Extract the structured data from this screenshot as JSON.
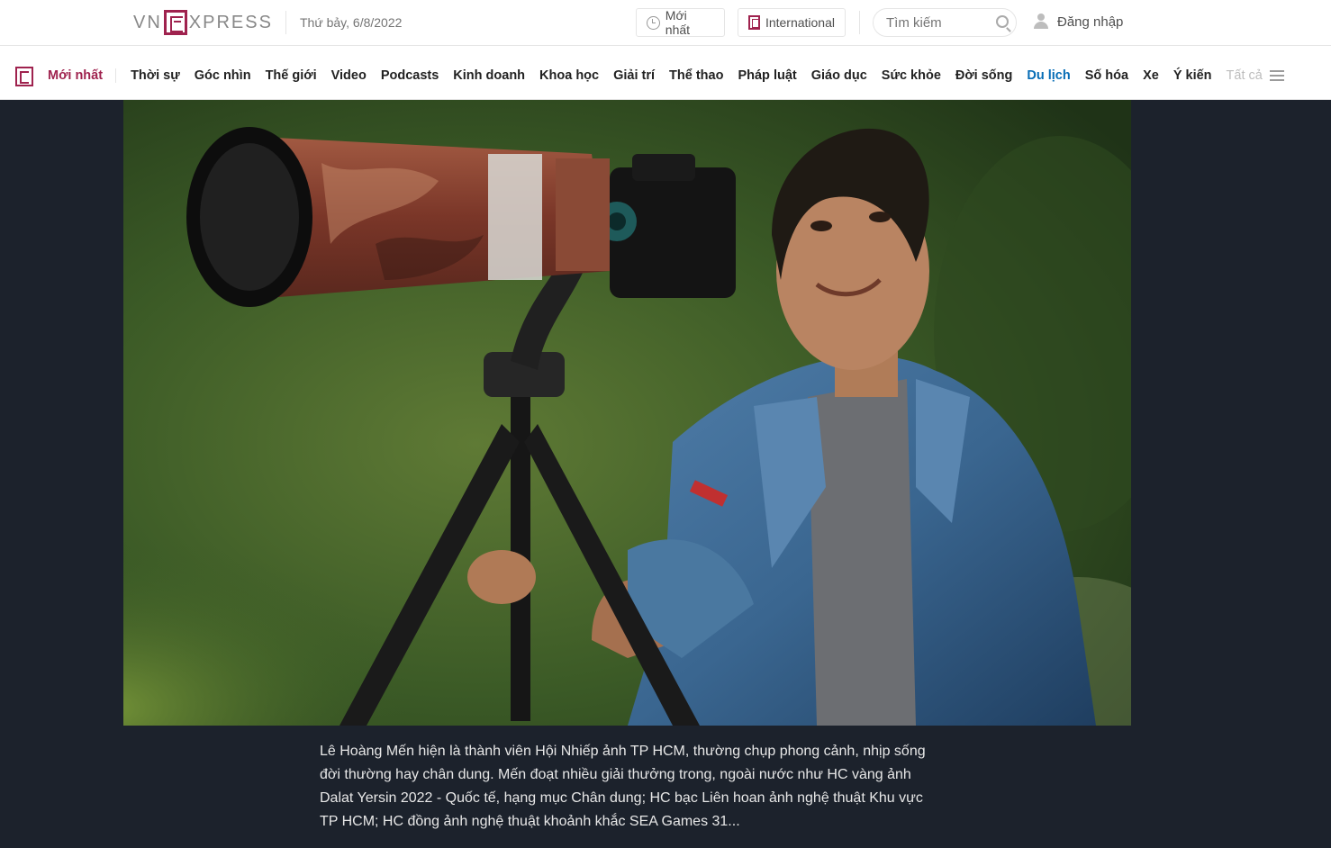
{
  "header": {
    "logo_left": "VN",
    "logo_right": "XPRESS",
    "date": "Thứ bảy, 6/8/2022",
    "newest_label": "Mới nhất",
    "international_label": "International",
    "search_placeholder": "Tìm kiếm",
    "login_label": "Đăng nhập"
  },
  "nav": {
    "items": [
      {
        "label": "Mới nhất"
      },
      {
        "label": "Thời sự"
      },
      {
        "label": "Góc nhìn"
      },
      {
        "label": "Thế giới"
      },
      {
        "label": "Video"
      },
      {
        "label": "Podcasts"
      },
      {
        "label": "Kinh doanh"
      },
      {
        "label": "Khoa học"
      },
      {
        "label": "Giải trí"
      },
      {
        "label": "Thể thao"
      },
      {
        "label": "Pháp luật"
      },
      {
        "label": "Giáo dục"
      },
      {
        "label": "Sức khỏe"
      },
      {
        "label": "Đời sống"
      },
      {
        "label": "Du lịch"
      },
      {
        "label": "Số hóa"
      },
      {
        "label": "Xe"
      },
      {
        "label": "Ý kiến"
      },
      {
        "label": "Tất cả"
      }
    ],
    "active_index": 14,
    "accent_color": "#9f224e",
    "active_color": "#076db6"
  },
  "gallery": {
    "background": "#1c222c",
    "caption": "Lê Hoàng Mến hiện là thành viên Hội Nhiếp ảnh TP HCM, thường chụp phong cảnh, nhịp sống đời thường hay chân dung. Mến đoạt nhiều giải thưởng trong, ngoài nước như HC vàng ảnh Dalat Yersin 2022 - Quốc tế, hạng mục Chân dung; HC bạc Liên hoan ảnh nghệ thuật Khu vực TP HCM; HC đồng ảnh nghệ thuật khoảnh khắc SEA Games 31..."
  }
}
